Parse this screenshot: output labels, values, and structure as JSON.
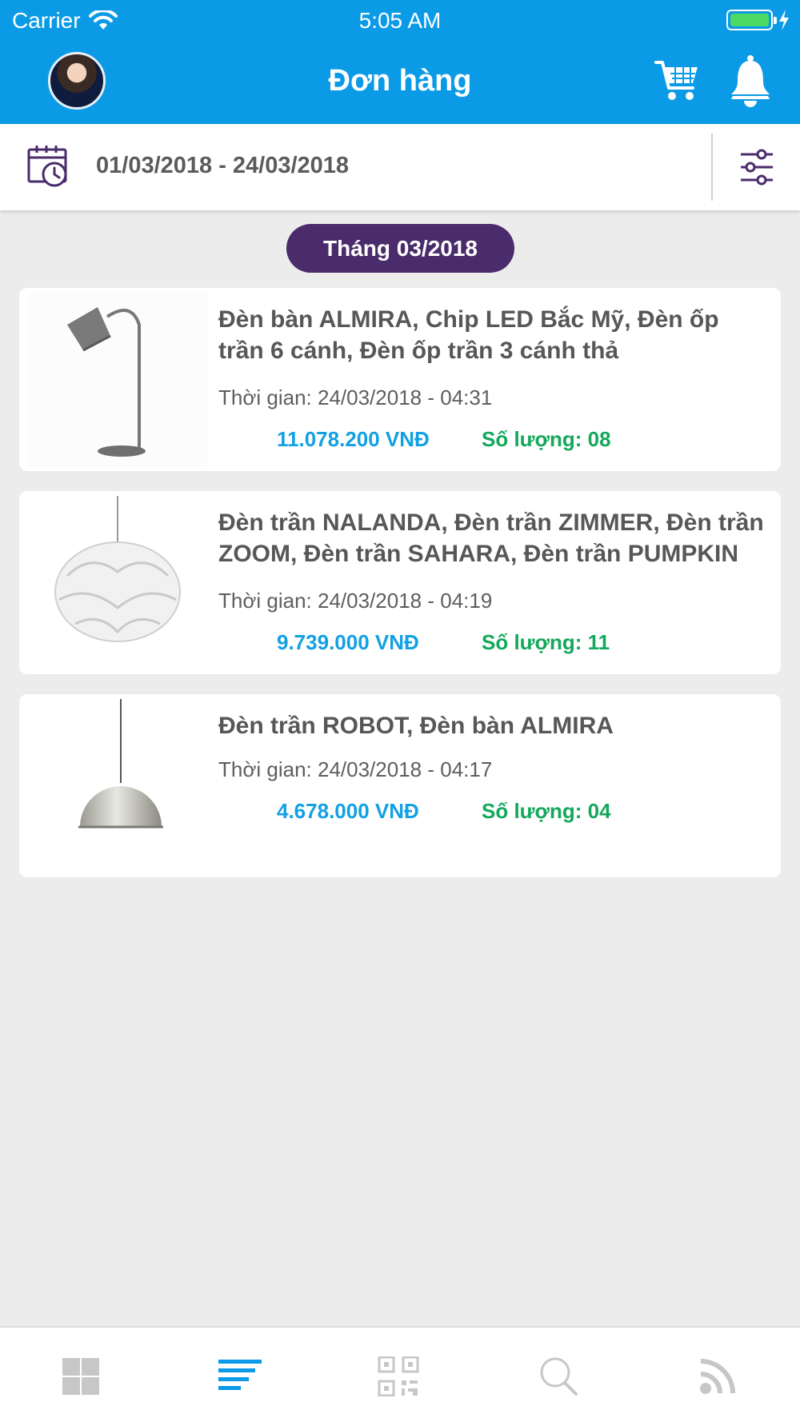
{
  "status_bar": {
    "carrier": "Carrier",
    "time": "5:05 AM"
  },
  "header": {
    "title": "Đơn hàng",
    "avatar_icon": "user-avatar",
    "cart_icon": "cart-icon",
    "bell_icon": "bell-icon"
  },
  "filter": {
    "date_range": "01/03/2018 - 24/03/2018",
    "calendar_icon": "calendar-clock-icon",
    "filter_icon": "sliders-icon"
  },
  "month_label": "Tháng 03/2018",
  "orders": [
    {
      "title": "Đèn bàn ALMIRA, Chip LED Bắc Mỹ, Đèn ốp trần 6 cánh, Đèn ốp trần 3 cánh thả",
      "time": "Thời gian: 24/03/2018 - 04:31",
      "price": "11.078.200 VNĐ",
      "qty": "Số lượng: 08",
      "image": "floor-lamp"
    },
    {
      "title": "Đèn trần NALANDA, Đèn trần ZIMMER, Đèn trần ZOOM, Đèn trần SAHARA, Đèn trần PUMPKIN",
      "time": "Thời gian: 24/03/2018 - 04:19",
      "price": "9.739.000 VNĐ",
      "qty": "Số lượng: 11",
      "image": "pendant-lamp-white"
    },
    {
      "title": "Đèn trần ROBOT, Đèn bàn ALMIRA",
      "time": "Thời gian: 24/03/2018 - 04:17",
      "price": "4.678.000 VNĐ",
      "qty": "Số lượng: 04",
      "image": "pendant-lamp-dome"
    }
  ],
  "tab_bar": {
    "tabs": [
      "dashboard-icon",
      "orders-list-icon",
      "qr-code-icon",
      "search-icon",
      "rss-icon"
    ],
    "active": "orders-list-icon",
    "active_color": "#0a9ae6",
    "inactive_color": "#c7c7c7"
  },
  "colors": {
    "header": "#0a9ae6",
    "pill": "#4a2b6b",
    "price": "#12a0e4",
    "qty": "#13a85b"
  }
}
